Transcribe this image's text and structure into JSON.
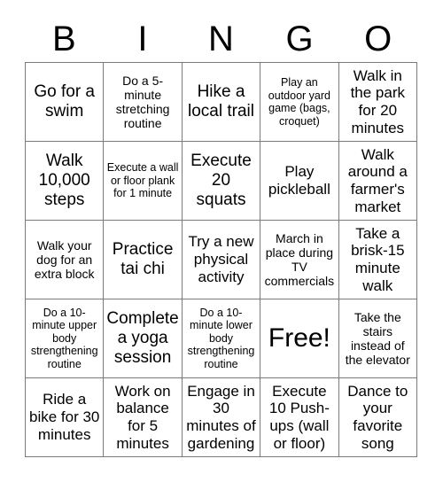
{
  "card": {
    "title_letters": [
      "B",
      "I",
      "N",
      "G",
      "O"
    ],
    "columns": 5,
    "rows": 5,
    "border_color": "#7a7a7a",
    "text_color": "#000000",
    "background_color": "#ffffff",
    "free_space_label": "Free!",
    "cells": [
      [
        {
          "text": "Go for a swim",
          "size": "lg"
        },
        {
          "text": "Do a 5-minute stretching routine",
          "size": "sm"
        },
        {
          "text": "Hike a local trail",
          "size": "lg"
        },
        {
          "text": "Play an outdoor yard game (bags, croquet)",
          "size": "xs"
        },
        {
          "text": "Walk in the park for 20 minutes",
          "size": "md"
        }
      ],
      [
        {
          "text": "Walk 10,000 steps",
          "size": "lg"
        },
        {
          "text": "Execute a wall or floor plank for 1 minute",
          "size": "xs"
        },
        {
          "text": "Execute 20 squats",
          "size": "lg"
        },
        {
          "text": "Play pickleball",
          "size": "md"
        },
        {
          "text": "Walk around a farmer's market",
          "size": "md"
        }
      ],
      [
        {
          "text": "Walk your dog for an extra block",
          "size": "sm"
        },
        {
          "text": "Practice tai chi",
          "size": "lg"
        },
        {
          "text": "Try a new physical activity",
          "size": "md"
        },
        {
          "text": "March in place during TV commercials",
          "size": "sm"
        },
        {
          "text": "Take a brisk-15 minute walk",
          "size": "md"
        }
      ],
      [
        {
          "text": "Do a 10-minute upper body strengthening routine",
          "size": "xs"
        },
        {
          "text": "Complete a yoga session",
          "size": "lg"
        },
        {
          "text": "Do a 10-minute lower body strengthening routine",
          "size": "xs"
        },
        {
          "text": "Free!",
          "size": "xl"
        },
        {
          "text": "Take the stairs instead of the elevator",
          "size": "sm"
        }
      ],
      [
        {
          "text": "Ride a bike for 30 minutes",
          "size": "md"
        },
        {
          "text": "Work on balance for 5 minutes",
          "size": "md"
        },
        {
          "text": "Engage in 30 minutes of gardening",
          "size": "md"
        },
        {
          "text": "Execute 10 Push-ups (wall or floor)",
          "size": "md"
        },
        {
          "text": "Dance to your favorite song",
          "size": "md"
        }
      ]
    ]
  }
}
